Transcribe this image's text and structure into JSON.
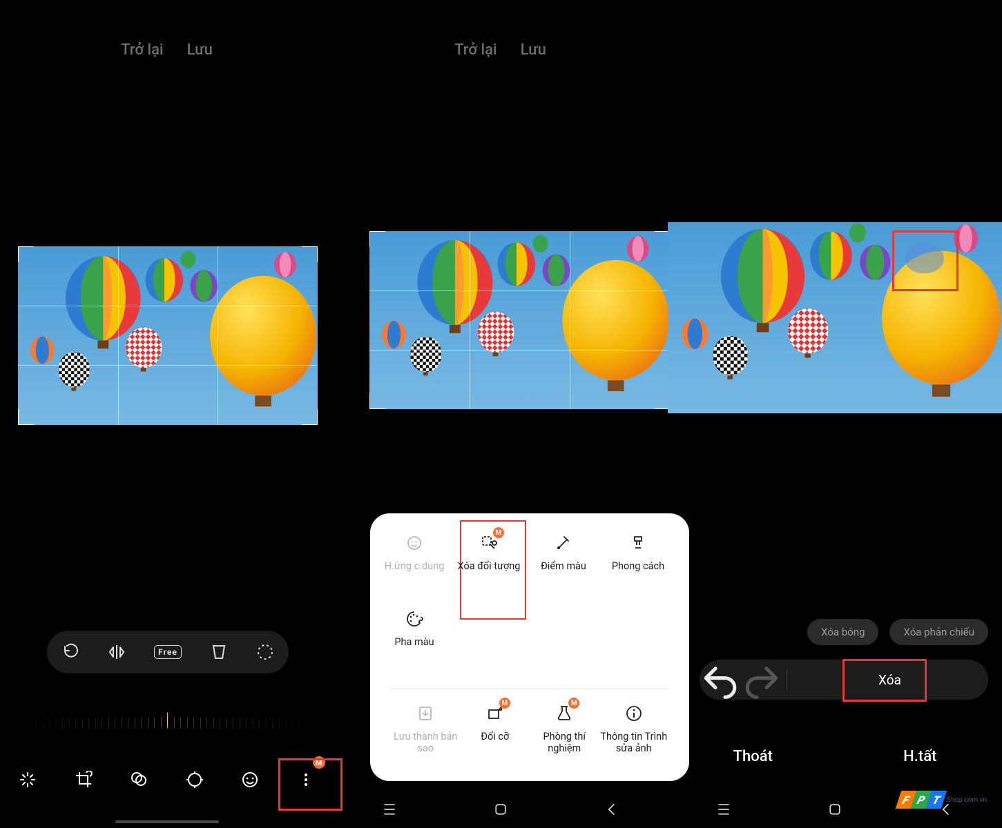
{
  "panel1": {
    "top": {
      "back": "Trở lại",
      "save": "Lưu"
    },
    "transform_tools": [
      "rotate",
      "flip-horizontal",
      "ratio-free",
      "perspective",
      "lasso"
    ],
    "ratio_free_label": "Free",
    "bottom_tabs": {
      "auto": "",
      "crop": "",
      "filter": "",
      "adjust": "",
      "sticker": "",
      "more": ""
    },
    "more_badge": "M"
  },
  "panel2": {
    "top": {
      "back": "Trở lại",
      "save": "Lưu"
    },
    "sheet": {
      "row1": [
        {
          "key": "portrait-effect",
          "label": "H.ứng c.dung",
          "dim": true
        },
        {
          "key": "object-eraser",
          "label": "Xóa đối tượng",
          "badge": "M",
          "highlight": true
        },
        {
          "key": "spot-color",
          "label": "Điểm màu"
        },
        {
          "key": "style",
          "label": "Phong cách"
        }
      ],
      "row2": [
        {
          "key": "color-mix",
          "label": "Pha màu"
        }
      ],
      "row3": [
        {
          "key": "save-as-copy",
          "label": "Lưu thành bản sao",
          "dim": true
        },
        {
          "key": "resize",
          "label": "Đổi cỡ",
          "badge": "M"
        },
        {
          "key": "labs",
          "label": "Phòng thí nghiệm",
          "badge": "M"
        },
        {
          "key": "about-editor",
          "label": "Thông tin Trình sửa ảnh"
        }
      ]
    }
  },
  "panel3": {
    "chips": {
      "shadow": "Xóa bóng",
      "reflection": "Xóa phản chiếu"
    },
    "erase_action": "Xóa",
    "exit": "Thoát",
    "done": "H.tất",
    "watermark": {
      "brand": "FPT",
      "sub": "Shop.com.vn"
    }
  }
}
